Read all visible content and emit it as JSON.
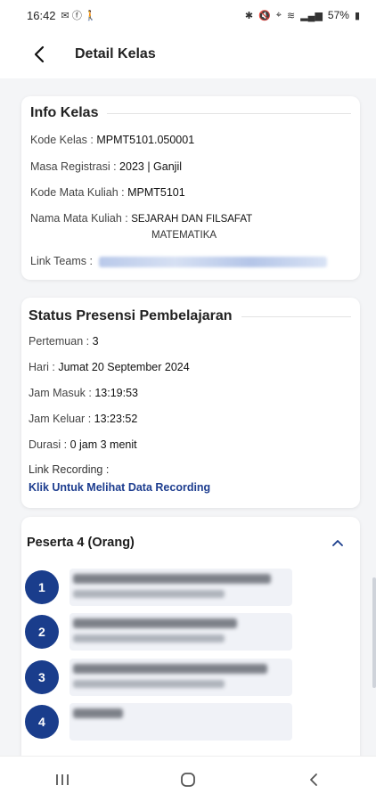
{
  "status_bar": {
    "time": "16:42",
    "left_icons": "✉ ⓕ 🚶",
    "battery": "57%"
  },
  "app_bar": {
    "title": "Detail Kelas"
  },
  "info_kelas": {
    "title": "Info Kelas",
    "kode_kelas_label": "Kode Kelas :",
    "kode_kelas_value": "MPMT5101.050001",
    "masa_registrasi_label": "Masa Registrasi :",
    "masa_registrasi_value": "2023 | Ganjil",
    "kode_mk_label": "Kode Mata Kuliah :",
    "kode_mk_value": "MPMT5101",
    "nama_mk_label": "Nama Mata Kuliah :",
    "nama_mk_value_line1": "SEJARAH DAN FILSAFAT",
    "nama_mk_value_line2": "MATEMATIKA",
    "link_teams_label": "Link Teams :"
  },
  "status_presensi": {
    "title": "Status Presensi Pembelajaran",
    "pertemuan_label": "Pertemuan :",
    "pertemuan_value": "3",
    "hari_label": "Hari :",
    "hari_value": "Jumat 20 September 2024",
    "jam_masuk_label": "Jam Masuk :",
    "jam_masuk_value": "13:19:53",
    "jam_keluar_label": "Jam Keluar :",
    "jam_keluar_value": "13:23:52",
    "durasi_label": "Durasi :",
    "durasi_value": "0 jam 3 menit",
    "link_recording_label": "Link Recording :",
    "link_recording_text": "Klik Untuk Melihat Data Recording"
  },
  "peserta": {
    "title": "Peserta 4 (Orang)",
    "items": [
      {
        "number": "1"
      },
      {
        "number": "2"
      },
      {
        "number": "3"
      },
      {
        "number": "4"
      }
    ]
  },
  "colors": {
    "accent": "#1a3d8c",
    "link": "#1d3d8f",
    "background": "#f4f5f7"
  }
}
